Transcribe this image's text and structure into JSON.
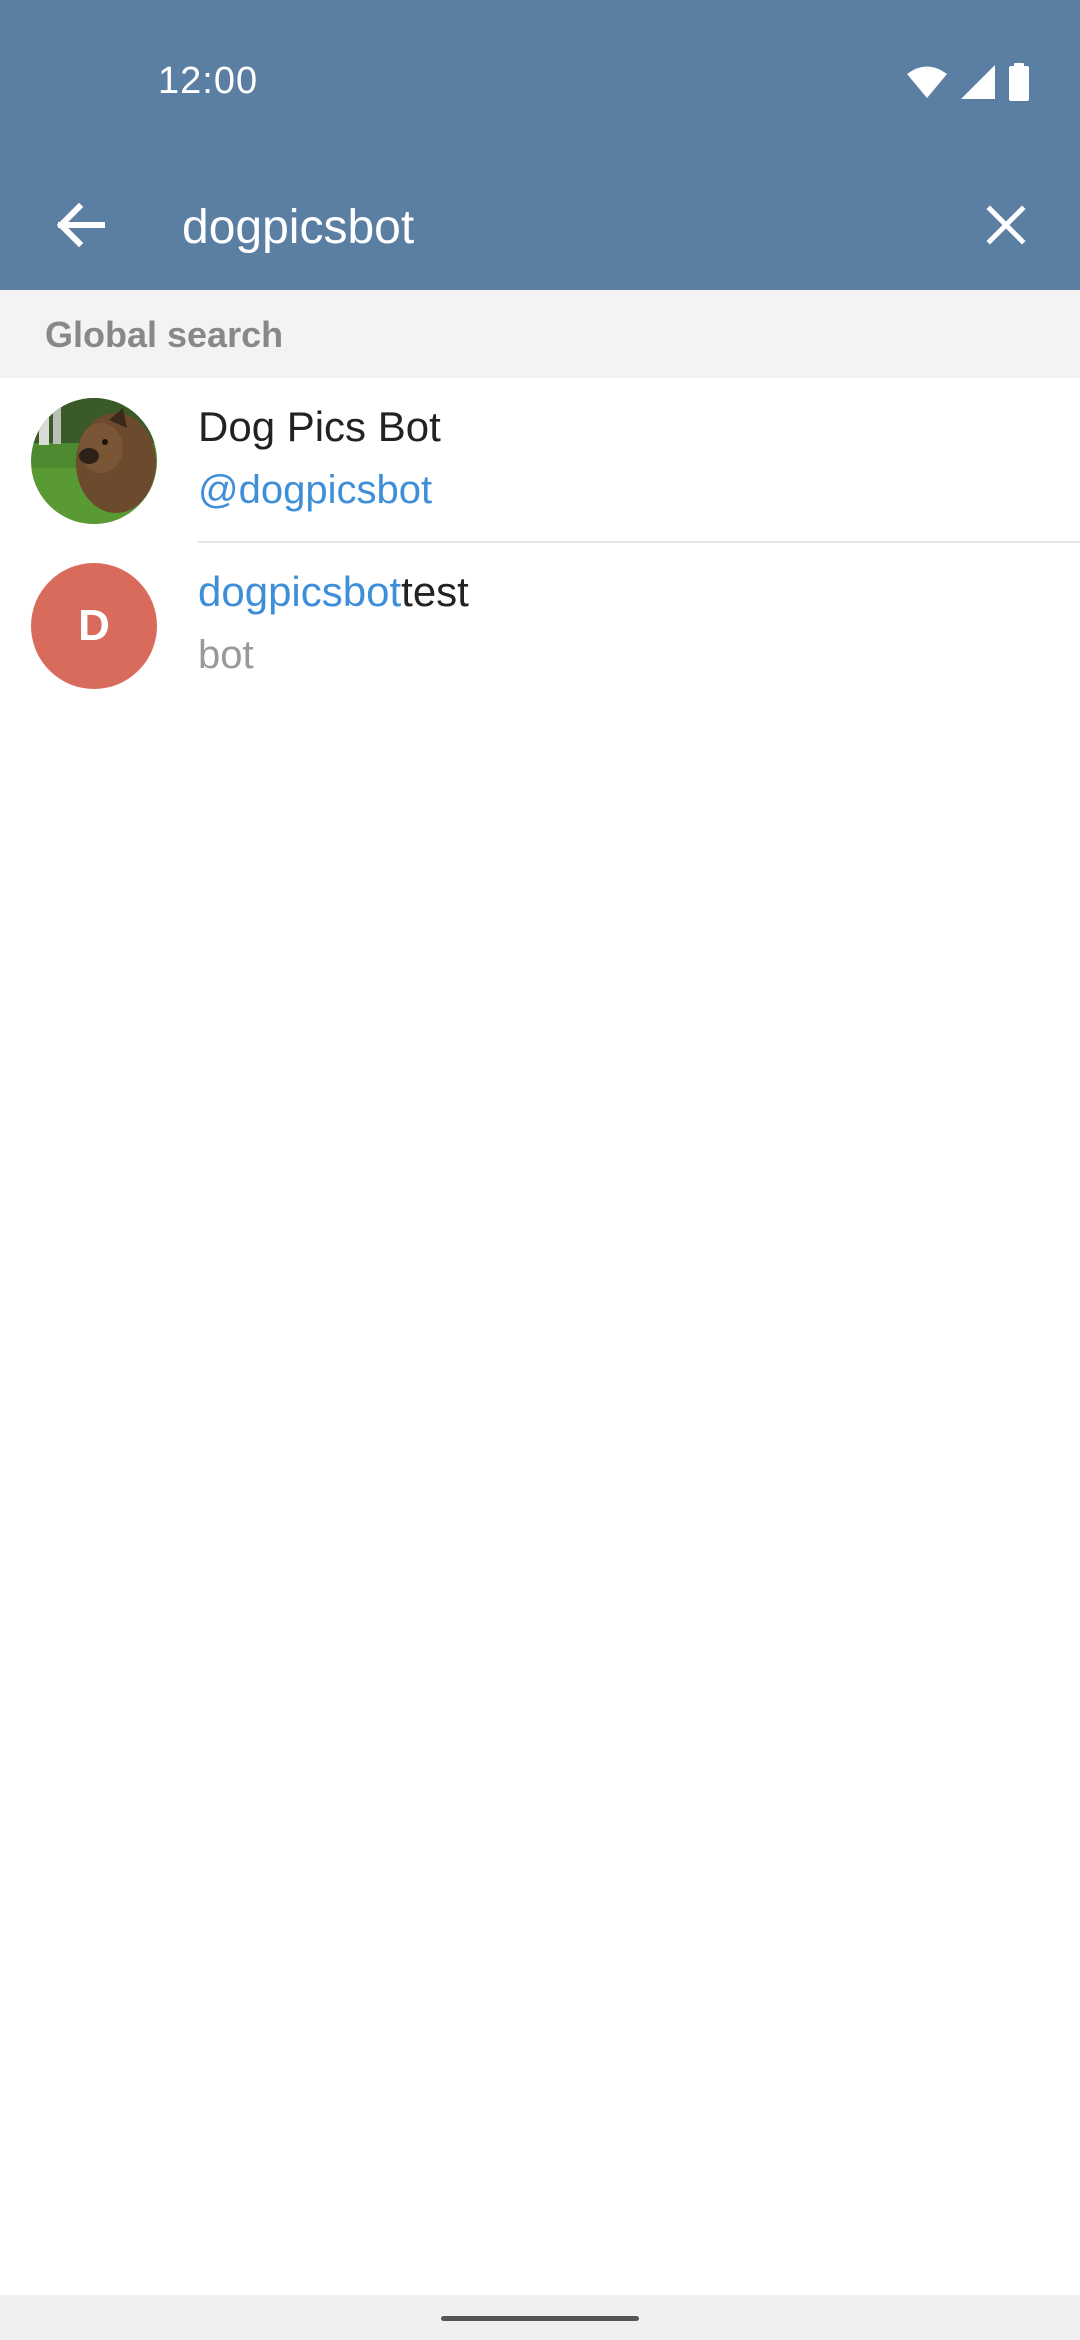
{
  "status_bar": {
    "time": "12:00",
    "icons": [
      "wifi-icon",
      "signal-icon",
      "battery-icon"
    ]
  },
  "toolbar": {
    "back_icon": "arrow-left-icon",
    "search_value": "dogpicsbot",
    "clear_icon": "close-icon"
  },
  "section": {
    "title": "Global search"
  },
  "results": [
    {
      "title": "Dog Pics Bot",
      "subtitle": "@dogpicsbot",
      "avatar": "dog-photo",
      "subtitle_color": "#3e8ed8"
    },
    {
      "title_highlight": "dogpicsbot",
      "title_rest": "test",
      "subtitle": "bot",
      "avatar_letter": "D",
      "avatar_color": "#d86b5b",
      "subtitle_color": "#999999"
    }
  ],
  "colors": {
    "header": "#5b7ea3",
    "accent": "#3e8ed8",
    "section_bg": "#f3f3f4"
  }
}
